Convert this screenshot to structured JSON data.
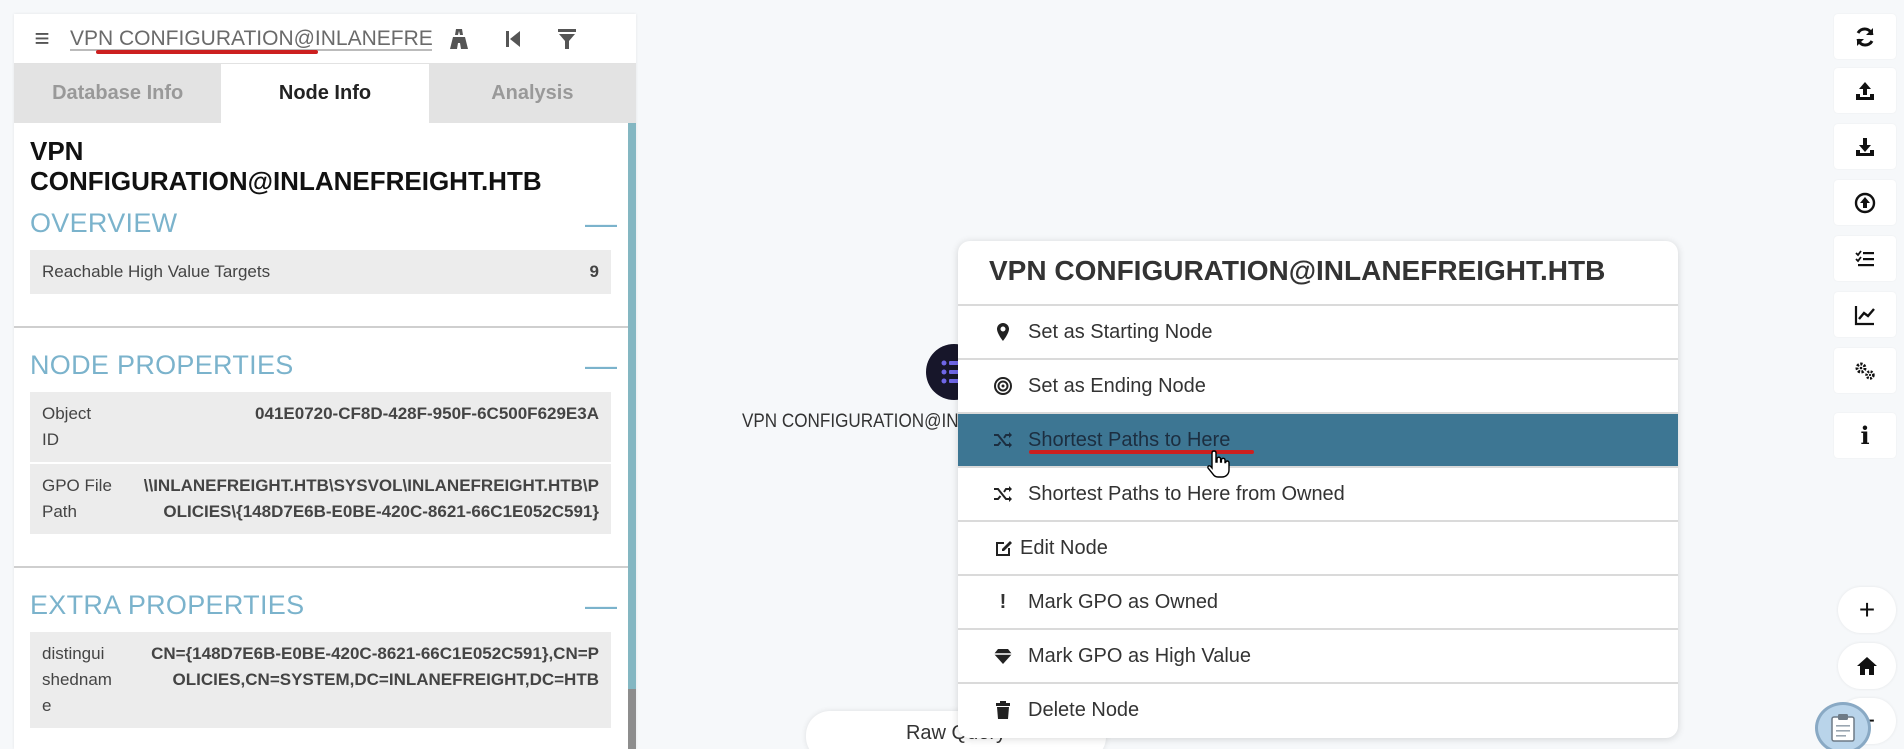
{
  "search": {
    "value": "VPN CONFIGURATION@INLANEFREIGHT.HTB",
    "icons": [
      "menu-icon",
      "pathfinding-icon",
      "back-icon",
      "filter-icon"
    ]
  },
  "tabs": [
    {
      "label": "Database Info",
      "active": false
    },
    {
      "label": "Node Info",
      "active": true
    },
    {
      "label": "Analysis",
      "active": false
    }
  ],
  "node": {
    "title": "VPN CONFIGURATION@INLANEFREIGHT.HTB",
    "overview": {
      "title": "OVERVIEW",
      "collapse": "—",
      "rows": [
        {
          "key": "Reachable High Value Targets",
          "value": "9"
        }
      ]
    },
    "node_properties": {
      "title": "NODE PROPERTIES",
      "collapse": "—",
      "rows": [
        {
          "key": "Object ID",
          "value": "041E0720-CF8D-428F-950F-6C500F629E3A"
        },
        {
          "key": "GPO File Path",
          "value": "\\\\INLANEFREIGHT.HTB\\SYSVOL\\INLANEFREIGHT.HTB\\POLICIES\\{148D7E6B-E0BE-420C-8621-66C1E052C591}"
        }
      ]
    },
    "extra_properties": {
      "title": "EXTRA PROPERTIES",
      "collapse": "—",
      "rows": [
        {
          "key": "distinguishedname",
          "value": "CN={148D7E6B-E0BE-420C-8621-66C1E052C591},CN=POLICIES,CN=SYSTEM,DC=INLANEFREIGHT,DC=HTB"
        }
      ]
    }
  },
  "graph": {
    "node_label": "VPN CONFIGURATION@INLANEFREIGHT.HTB",
    "node_icon": "gpo-list-icon"
  },
  "context_menu": {
    "title": "VPN CONFIGURATION@INLANEFREIGHT.HTB",
    "items": [
      {
        "label": "Set as Starting Node",
        "icon": "map-marker-icon"
      },
      {
        "label": "Set as Ending Node",
        "icon": "bullseye-icon"
      },
      {
        "label": "Shortest Paths to Here",
        "icon": "shuffle-icon",
        "active": true
      },
      {
        "label": "Shortest Paths to Here from Owned",
        "icon": "shuffle-icon"
      },
      {
        "label": "Edit Node",
        "icon": "edit-icon"
      },
      {
        "label": "Mark GPO as Owned",
        "icon": "exclamation-icon",
        "glyph": "!"
      },
      {
        "label": "Mark GPO as High Value",
        "icon": "diamond-icon"
      },
      {
        "label": "Delete Node",
        "icon": "trash-icon"
      }
    ]
  },
  "raw_query": {
    "label": "Raw Query"
  },
  "toolbar": {
    "buttons": [
      "refresh-icon",
      "upload-icon",
      "download-icon",
      "import-icon",
      "queries-icon",
      "stats-icon",
      "settings-icon",
      "info-icon"
    ],
    "info_glyph": "i",
    "zoom_in": "+",
    "zoom_out": "−"
  },
  "colors": {
    "accent": "#7bb3cc",
    "menu_active": "#3d7693",
    "annotation": "#cc1f1f",
    "node": "#17162a"
  }
}
